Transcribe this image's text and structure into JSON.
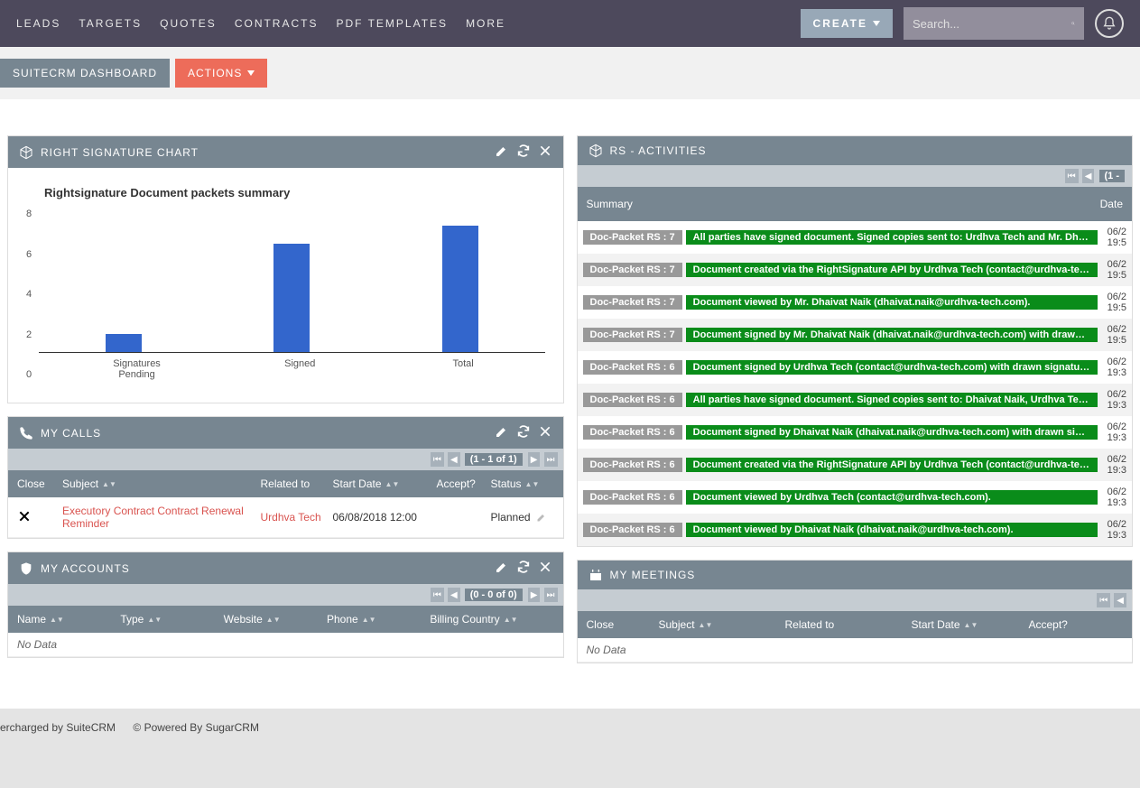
{
  "nav": {
    "items": [
      "LEADS",
      "TARGETS",
      "QUOTES",
      "CONTRACTS",
      "PDF TEMPLATES",
      "MORE"
    ],
    "create_label": "CREATE",
    "search_placeholder": "Search..."
  },
  "subnav": {
    "dashboard_label": "SUITECRM DASHBOARD",
    "actions_label": "ACTIONS"
  },
  "chart_panel": {
    "title": "RIGHT SIGNATURE CHART"
  },
  "chart_data": {
    "type": "bar",
    "title": "Rightsignature Document packets summary",
    "categories": [
      "Signatures Pending",
      "Signed",
      "Total"
    ],
    "values": [
      1,
      6,
      7
    ],
    "ylim": [
      0,
      8
    ],
    "yticks": [
      0,
      2,
      4,
      6,
      8
    ]
  },
  "activities_panel": {
    "title": "RS - ACTIVITIES",
    "pager": "(1 -",
    "columns": {
      "summary": "Summary",
      "date": "Date"
    },
    "rows": [
      {
        "tag": "Doc-Packet RS : 7",
        "msg": "All parties have signed document. Signed copies sent to: Urdhva Tech and Mr. Dhaivat Naik.",
        "date": "06/2",
        "time": "19:5"
      },
      {
        "tag": "Doc-Packet RS : 7",
        "msg": "Document created via the RightSignature API by Urdhva Tech (contact@urdhva-tech.com).",
        "date": "06/2",
        "time": "19:5"
      },
      {
        "tag": "Doc-Packet RS : 7",
        "msg": "Document viewed by Mr. Dhaivat Naik (dhaivat.naik@urdhva-tech.com).",
        "date": "06/2",
        "time": "19:5"
      },
      {
        "tag": "Doc-Packet RS : 7",
        "msg": "Document signed by Mr. Dhaivat Naik (dhaivat.naik@urdhva-tech.com) with drawn signature.",
        "date": "06/2",
        "time": "19:5"
      },
      {
        "tag": "Doc-Packet RS : 6",
        "msg": "Document signed by Urdhva Tech (contact@urdhva-tech.com) with drawn signature.",
        "date": "06/2",
        "time": "19:3"
      },
      {
        "tag": "Doc-Packet RS : 6",
        "msg": "All parties have signed document. Signed copies sent to: Dhaivat Naik, Urdhva Tech, and Urdhva Tech.",
        "date": "06/2",
        "time": "19:3"
      },
      {
        "tag": "Doc-Packet RS : 6",
        "msg": "Document signed by Dhaivat Naik (dhaivat.naik@urdhva-tech.com) with drawn signature.",
        "date": "06/2",
        "time": "19:3"
      },
      {
        "tag": "Doc-Packet RS : 6",
        "msg": "Document created via the RightSignature API by Urdhva Tech (contact@urdhva-tech.com).",
        "date": "06/2",
        "time": "19:3"
      },
      {
        "tag": "Doc-Packet RS : 6",
        "msg": "Document viewed by Urdhva Tech (contact@urdhva-tech.com).",
        "date": "06/2",
        "time": "19:3"
      },
      {
        "tag": "Doc-Packet RS : 6",
        "msg": "Document viewed by Dhaivat Naik (dhaivat.naik@urdhva-tech.com).",
        "date": "06/2",
        "time": "19:3"
      }
    ]
  },
  "calls_panel": {
    "title": "MY CALLS",
    "pager": "(1 - 1 of 1)",
    "columns": {
      "close": "Close",
      "subject": "Subject",
      "related": "Related to",
      "start": "Start Date",
      "accept": "Accept?",
      "status": "Status"
    },
    "rows": [
      {
        "subject": "Executory Contract Contract Renewal Reminder",
        "related": "Urdhva Tech",
        "start": "06/08/2018 12:00",
        "accept": "",
        "status": "Planned"
      }
    ]
  },
  "accounts_panel": {
    "title": "MY ACCOUNTS",
    "pager": "(0 - 0 of 0)",
    "columns": {
      "name": "Name",
      "type": "Type",
      "website": "Website",
      "phone": "Phone",
      "billing": "Billing Country"
    },
    "no_data": "No Data"
  },
  "meetings_panel": {
    "title": "MY MEETINGS",
    "columns": {
      "close": "Close",
      "subject": "Subject",
      "related": "Related to",
      "start": "Start Date",
      "accept": "Accept?"
    },
    "no_data": "No Data"
  },
  "footer": {
    "left": "ercharged by SuiteCRM",
    "right": "© Powered By SugarCRM"
  }
}
